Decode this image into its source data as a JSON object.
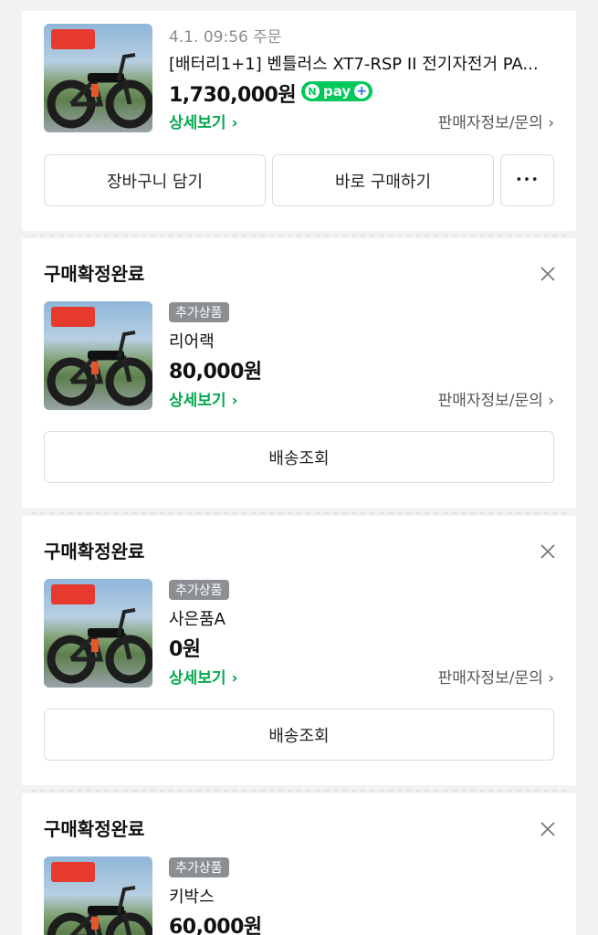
{
  "orders": [
    {
      "order_date": "4.1. 09:56 주문",
      "title": "[배터리1+1] 벤틀러스 XT7-RSP II 전기자전거 PA...",
      "price": "1,730,000원",
      "npay_label": "pay",
      "detail_label": "상세보기 ›",
      "seller_label": "판매자정보/문의 ›",
      "buttons": {
        "cart": "장바구니 담기",
        "buy_now": "바로 구매하기",
        "more": "•••"
      }
    }
  ],
  "items": [
    {
      "status": "구매확정완료",
      "badge": "추가상품",
      "name": "리어랙",
      "price": "80,000원",
      "detail_label": "상세보기 ›",
      "seller_label": "판매자정보/문의 ›",
      "action": "배송조회"
    },
    {
      "status": "구매확정완료",
      "badge": "추가상품",
      "name": "사은품A",
      "price": "0원",
      "detail_label": "상세보기 ›",
      "seller_label": "판매자정보/문의 ›",
      "action": "배송조회"
    },
    {
      "status": "구매확정완료",
      "badge": "추가상품",
      "name": "키박스",
      "price": "60,000원"
    }
  ],
  "colors": {
    "accent_green": "#03c75a",
    "link_green": "#03a94d"
  }
}
